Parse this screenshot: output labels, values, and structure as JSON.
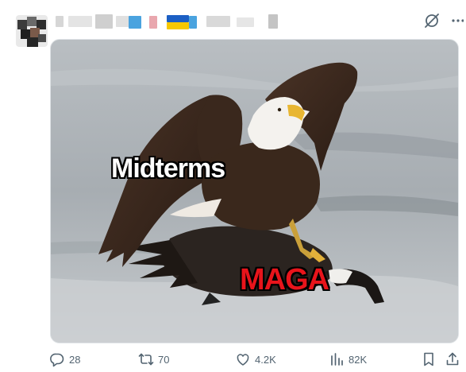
{
  "post": {
    "author_name": "",
    "media": {
      "captions": {
        "top": "Midterms",
        "bottom": "MAGA"
      }
    },
    "actions": {
      "replies": "28",
      "reposts": "70",
      "likes": "4.2K",
      "views": "82K"
    }
  },
  "icons": {
    "grok": "grok-slash-circle-icon",
    "more": "more-dots-icon",
    "reply": "reply-bubble-icon",
    "repost": "repost-arrows-icon",
    "like": "heart-icon",
    "views": "analytics-bars-icon",
    "bookmark": "bookmark-icon",
    "share": "share-upload-icon"
  },
  "colors": {
    "icon_gray": "#536471",
    "caption_red": "#e8141b",
    "caption_white": "#ffffff"
  }
}
